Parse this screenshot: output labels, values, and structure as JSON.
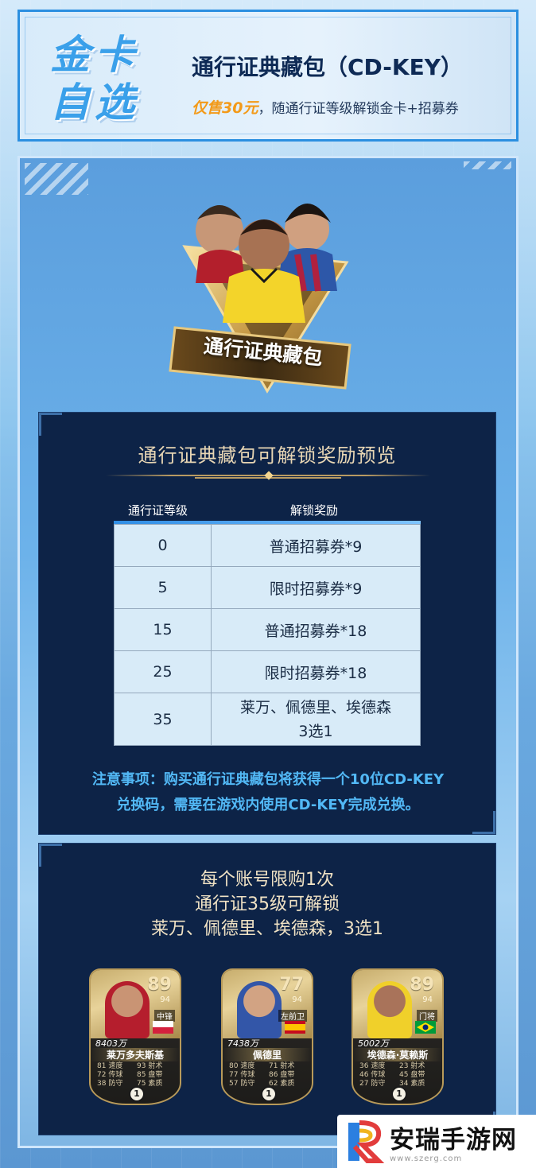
{
  "header": {
    "brand_line1": "金卡",
    "brand_line2": "自选",
    "title": "通行证典藏包（CD-KEY）",
    "price": "仅售30元",
    "subtitle": "，随通行证等级解锁金卡+招募券"
  },
  "emblem": {
    "label": "通行证典藏包"
  },
  "rewards_panel": {
    "title": "通行证典藏包可解锁奖励预览",
    "col_level": "通行证等级",
    "col_reward": "解锁奖励",
    "rows": [
      {
        "level": "0",
        "reward": "普通招募券*9"
      },
      {
        "level": "5",
        "reward": "限时招募券*9"
      },
      {
        "level": "15",
        "reward": "普通招募券*18"
      },
      {
        "level": "25",
        "reward": "限时招募券*18"
      },
      {
        "level": "35",
        "reward_line1": "莱万、佩德里、埃德森",
        "reward_line2": "3选1"
      }
    ],
    "notice_line1": "注意事项：购买通行证典藏包将获得一个10位CD-KEY",
    "notice_line2": "兑换码，需要在游戏内使用CD-KEY完成兑换。"
  },
  "choice_panel": {
    "line1": "每个账号限购1次",
    "line2": "通行证35级可解锁",
    "line3": "莱万、佩德里、埃德森，3选1"
  },
  "cards": [
    {
      "rating": "89",
      "sub_rating": "94",
      "position": "中锋",
      "value": "8403万",
      "name": "莱万多夫斯基",
      "stats_left": [
        "81 速度",
        "72 传球",
        "38 防守"
      ],
      "stats_right": [
        "93 射术",
        "85 盘带",
        "75 素质"
      ],
      "level": "1",
      "flag": "poland"
    },
    {
      "rating": "77",
      "sub_rating": "94",
      "position": "左前卫",
      "value": "7438万",
      "name": "佩德里",
      "stats_left": [
        "80 速度",
        "77 传球",
        "57 防守"
      ],
      "stats_right": [
        "71 射术",
        "86 盘带",
        "62 素质"
      ],
      "level": "1",
      "flag": "spain"
    },
    {
      "rating": "89",
      "sub_rating": "94",
      "position": "门将",
      "value": "5002万",
      "name": "埃德森·莫赖斯",
      "stats_left": [
        "36 速度",
        "46 传球",
        "27 防守"
      ],
      "stats_right": [
        "23 射术",
        "45 盘带",
        "34 素质"
      ],
      "level": "1",
      "flag": "brazil"
    }
  ],
  "watermark": {
    "text": "安瑞手游网",
    "url": "www.szerg.com"
  },
  "colors": {
    "accent": "#2b8fe0",
    "panel": "#0d2347",
    "gold": "#b89a62",
    "notice": "#52b8f5"
  }
}
